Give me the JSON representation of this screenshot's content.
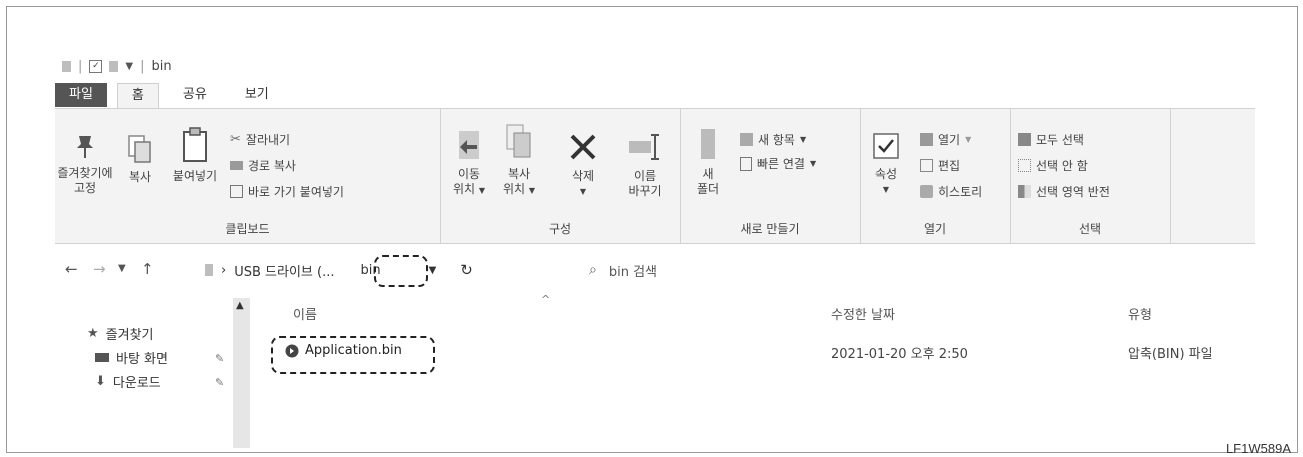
{
  "window": {
    "title": "bin"
  },
  "ribbon_tabs": [
    {
      "label": "파일"
    },
    {
      "label": "홈"
    },
    {
      "label": "공유"
    },
    {
      "label": "보기"
    }
  ],
  "clipboard": {
    "pin_line1": "즐겨찾기에",
    "pin_line2": "고정",
    "copy": "복사",
    "paste": "붙여넣기",
    "cut": "잘라내기",
    "copy_path": "경로 복사",
    "paste_shortcut": "바로 가기 붙여넣기",
    "label": "클립보드"
  },
  "organize": {
    "move_line1": "이동",
    "move_line2": "위치",
    "copyto_line1": "복사",
    "copyto_line2": "위치",
    "delete": "삭제",
    "rename_line1": "이름",
    "rename_line2": "바꾸기",
    "label": "구성"
  },
  "new": {
    "new_folder_line1": "새",
    "new_folder_line2": "폴더",
    "new_item": "새 항목",
    "easy_access": "빠른 연결",
    "label": "새로 만들기"
  },
  "open": {
    "properties": "속성",
    "open": "열기",
    "edit": "편집",
    "history": "히스토리",
    "label": "열기"
  },
  "select": {
    "select_all": "모두 선택",
    "select_none": "선택 안 함",
    "invert": "선택 영역 반전",
    "label": "선택"
  },
  "address": {
    "path_truncated": "USB 드라이브 (...",
    "current": "bin",
    "search_placeholder": "bin 검색"
  },
  "nav_pane": [
    {
      "label": "즐겨찾기"
    },
    {
      "label": "바탕 화면"
    },
    {
      "label": "다운로드"
    }
  ],
  "columns": {
    "name": "이름",
    "modified": "수정한 날짜",
    "type": "유형"
  },
  "files": [
    {
      "name": "Application.bin",
      "modified": "2021-01-20 오후 2:50",
      "type": "압축(BIN) 파일"
    }
  ],
  "figure_code": "LF1W589A"
}
